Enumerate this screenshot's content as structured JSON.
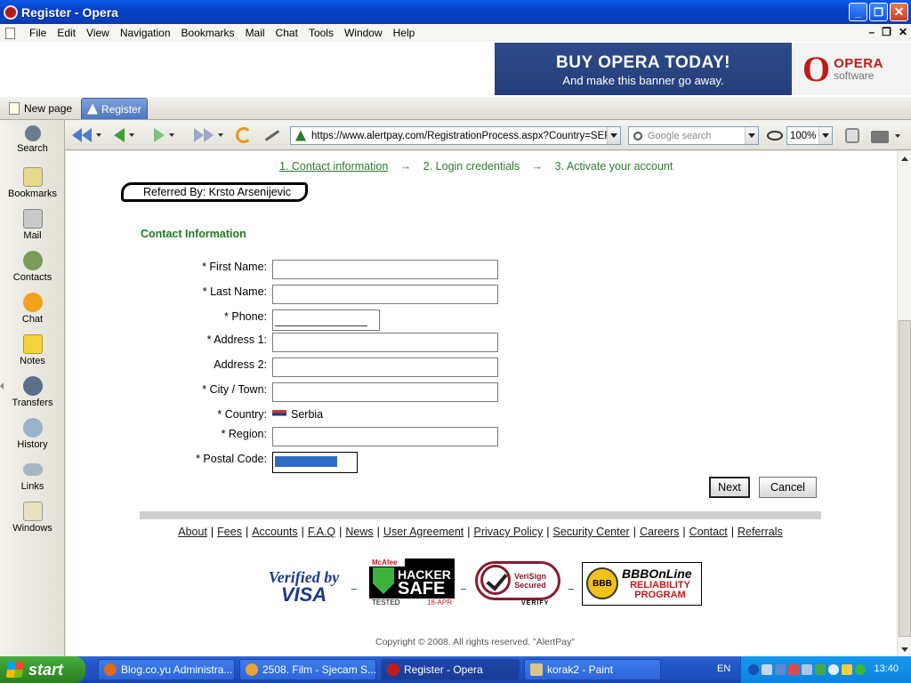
{
  "window": {
    "title": "Register - Opera"
  },
  "menu": [
    "File",
    "Edit",
    "View",
    "Navigation",
    "Bookmarks",
    "Mail",
    "Chat",
    "Tools",
    "Window",
    "Help"
  ],
  "banner": {
    "line1": "BUY OPERA TODAY!",
    "line2": "And make this banner go away.",
    "logo_main": "OPERA",
    "logo_sub": "software"
  },
  "tabs": {
    "new_page": "New page",
    "active": "Register"
  },
  "panel": [
    {
      "label": "Search",
      "icon": "search-icon",
      "color": "#6b7a8f"
    },
    {
      "label": "Bookmarks",
      "icon": "bookmarks-icon",
      "color": "#e8d98b"
    },
    {
      "label": "Mail",
      "icon": "mail-icon",
      "color": "#c9c9c9"
    },
    {
      "label": "Contacts",
      "icon": "contacts-icon",
      "color": "#7a9b5a"
    },
    {
      "label": "Chat",
      "icon": "chat-icon",
      "color": "#f0a21a"
    },
    {
      "label": "Notes",
      "icon": "notes-icon",
      "color": "#f5d23a"
    },
    {
      "label": "Transfers",
      "icon": "transfers-icon",
      "color": "#5c6f8a"
    },
    {
      "label": "History",
      "icon": "history-icon",
      "color": "#9bb3c9"
    },
    {
      "label": "Links",
      "icon": "links-icon",
      "color": "#a9b6c4"
    },
    {
      "label": "Windows",
      "icon": "windows-icon",
      "color": "#e8e2c0"
    }
  ],
  "toolbar": {
    "url": "https://www.alertpay.com/RegistrationProcess.aspx?Country=SER&",
    "search_placeholder": "Google search",
    "zoom": "100%"
  },
  "steps": {
    "step1": "1. Contact information",
    "arrow": "→",
    "step2": "2. Login credentials",
    "step3": "3. Activate your account"
  },
  "referred": "Referred By: Krsto Arsenijevic",
  "form": {
    "section_title": "Contact Information",
    "first_name_label": "* First Name:",
    "last_name_label": "* Last Name:",
    "phone_label": "* Phone:",
    "address1_label": "* Address 1:",
    "address2_label": "Address 2:",
    "city_label": "* City / Town:",
    "country_label": "* Country:",
    "country_value": "Serbia",
    "region_label": "* Region:",
    "postal_label": "* Postal Code:",
    "next_button": "Next",
    "cancel_button": "Cancel"
  },
  "footer": {
    "links": [
      "About",
      "Fees",
      "Accounts",
      "F.A.Q",
      "News",
      "User Agreement",
      "Privacy Policy",
      "Security Center",
      "Careers",
      "Contact",
      "Referrals"
    ],
    "badges": {
      "visa_line1": "Verified by",
      "visa_line2": "VISA",
      "hacker_top": "McAfee",
      "hacker_line1": "HACKER",
      "hacker_line2": "SAFE",
      "hacker_tested": "TESTED",
      "hacker_date": "18-APR",
      "verisign_line1": "VeriSign",
      "verisign_line2": "Secured",
      "verisign_verify": "VERIFY",
      "bbb_seal": "BBB",
      "bbb_line1": "BBBOnLine",
      "bbb_line2": "RELIABILITY PROGRAM"
    },
    "copyright": "Copyright © 2008. All rights reserved. \"AlertPay\""
  },
  "taskbar": {
    "start": "start",
    "tasks": [
      {
        "label": "Blog.co.yu Administra...",
        "color": "#e06a1a"
      },
      {
        "label": "2508. Film - Sjecam S...",
        "color": "#e8a23a"
      },
      {
        "label": "Register - Opera",
        "color": "#c21a1a"
      },
      {
        "label": "korak2 - Paint",
        "color": "#d9c58a"
      }
    ],
    "lang": "EN",
    "time": "13:40"
  }
}
